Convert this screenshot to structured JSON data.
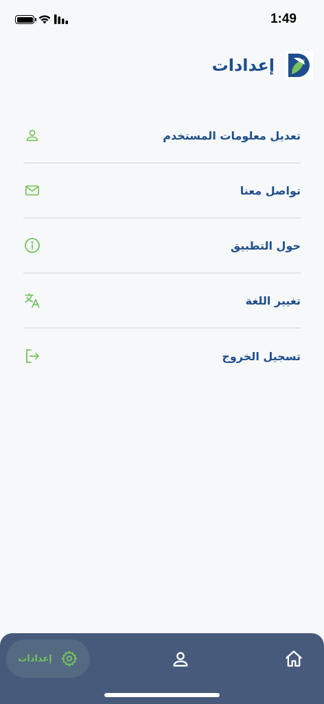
{
  "status_bar": {
    "time": "1:49"
  },
  "header": {
    "title": "إعدادات",
    "logo_icon": "app-logo-icon"
  },
  "menu": {
    "items": [
      {
        "label": "تعديل معلومات المستخدم",
        "icon": "user-icon"
      },
      {
        "label": "تواصل معنا",
        "icon": "mail-icon"
      },
      {
        "label": "حول التطبيق",
        "icon": "info-icon"
      },
      {
        "label": "تغيير اللغة",
        "icon": "translate-icon"
      },
      {
        "label": "تسجيل الخروج",
        "icon": "logout-icon"
      }
    ]
  },
  "bottom_nav": {
    "active_label": "إعدادات",
    "items": [
      "gear-icon",
      "profile-icon",
      "home-icon"
    ]
  },
  "colors": {
    "accent_green": "#76c25e",
    "primary_blue": "#1f4e8c",
    "nav_background": "#475a7b"
  }
}
